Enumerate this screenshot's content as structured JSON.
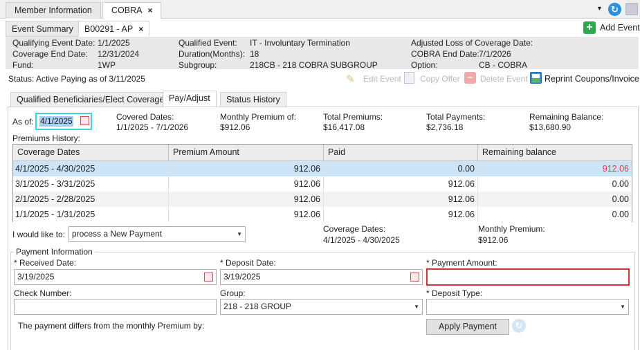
{
  "top_tabs": [
    {
      "label": "Member Information"
    },
    {
      "label": "COBRA",
      "close": "×"
    }
  ],
  "sub_tabs": [
    {
      "label": "Event Summary"
    },
    {
      "label": "B00291 - AP",
      "close": "×"
    }
  ],
  "toolbar": {
    "add_event": "Add Event"
  },
  "info": {
    "col1": [
      {
        "label": "Qualifying Event Date:",
        "value": "1/1/2025"
      },
      {
        "label": "Coverage End Date:",
        "value": "12/31/2024"
      },
      {
        "label": "Fund:",
        "value": "1WP"
      }
    ],
    "col2": [
      {
        "label": "Qualified Event:",
        "value": "IT - Involuntary Termination"
      },
      {
        "label": "Duration(Months):",
        "value": "18"
      },
      {
        "label": "Subgroup:",
        "value": "218CB - 218 COBRA SUBGROUP"
      }
    ],
    "col3": [
      {
        "label": "Adjusted Loss of Coverage Date:",
        "value": ""
      },
      {
        "label": "COBRA End Date:",
        "value": "7/1/2026"
      },
      {
        "label": "Option:",
        "value": "CB - COBRA"
      }
    ]
  },
  "status": "Status: Active Paying as of 3/11/2025",
  "actions": {
    "edit_event": "Edit Event",
    "copy_offer": "Copy Offer",
    "delete_event": "Delete Event",
    "reprint": "Reprint Coupons/Invoice"
  },
  "panel_tabs": [
    {
      "label": "Qualified Beneficiaries/Elect Coverage"
    },
    {
      "label": "Pay/Adjust"
    },
    {
      "label": "Status History"
    }
  ],
  "summary": {
    "as_of_label": "As of:",
    "as_of_value": "4/1/2025",
    "covered_dates_label": "Covered Dates:",
    "covered_dates_value": "1/1/2025 - 7/1/2026",
    "monthly_premium_label": "Monthly Premium of:",
    "monthly_premium_value": "$912.06",
    "total_premiums_label": "Total Premiums:",
    "total_premiums_value": "$16,417.08",
    "total_payments_label": "Total Payments:",
    "total_payments_value": "$2,736.18",
    "remaining_label": "Remaining Balance:",
    "remaining_value": "$13,680.90"
  },
  "history": {
    "title": "Premiums History:",
    "columns": [
      "Coverage Dates",
      "Premium Amount",
      "Paid",
      "Remaining balance"
    ],
    "rows": [
      {
        "dates": "4/1/2025 - 4/30/2025",
        "premium": "912.06",
        "paid": "0.00",
        "remaining": "912.06"
      },
      {
        "dates": "3/1/2025 - 3/31/2025",
        "premium": "912.06",
        "paid": "912.06",
        "remaining": "0.00"
      },
      {
        "dates": "2/1/2025 - 2/28/2025",
        "premium": "912.06",
        "paid": "912.06",
        "remaining": "0.00"
      },
      {
        "dates": "1/1/2025 - 1/31/2025",
        "premium": "912.06",
        "paid": "912.06",
        "remaining": "0.00"
      }
    ]
  },
  "action_select": {
    "label": "I would like to:",
    "value": "process a New Payment",
    "coverage_label": "Coverage Dates:",
    "coverage_value": "4/1/2025 - 4/30/2025",
    "premium_label": "Monthly Premium:",
    "premium_value": "$912.06"
  },
  "payment": {
    "legend": "Payment Information",
    "received_label": "* Received Date:",
    "received_value": "3/19/2025",
    "deposit_label": "* Deposit Date:",
    "deposit_value": "3/19/2025",
    "amount_label": "* Payment Amount:",
    "amount_value": "",
    "check_label": "Check Number:",
    "check_value": "",
    "group_label": "Group:",
    "group_value": "218 - 218 GROUP",
    "deposit_type_label": "* Deposit Type:",
    "deposit_type_value": "",
    "differs_text": "The payment differs from the monthly Premium by:",
    "apply_button": "Apply Payment"
  },
  "colors": {
    "selected_row": "#cce4f7",
    "negative": "#e0393e",
    "error_border": "#c8383c",
    "focus_border": "#3fd0e6",
    "add_green": "#2fa84f"
  }
}
